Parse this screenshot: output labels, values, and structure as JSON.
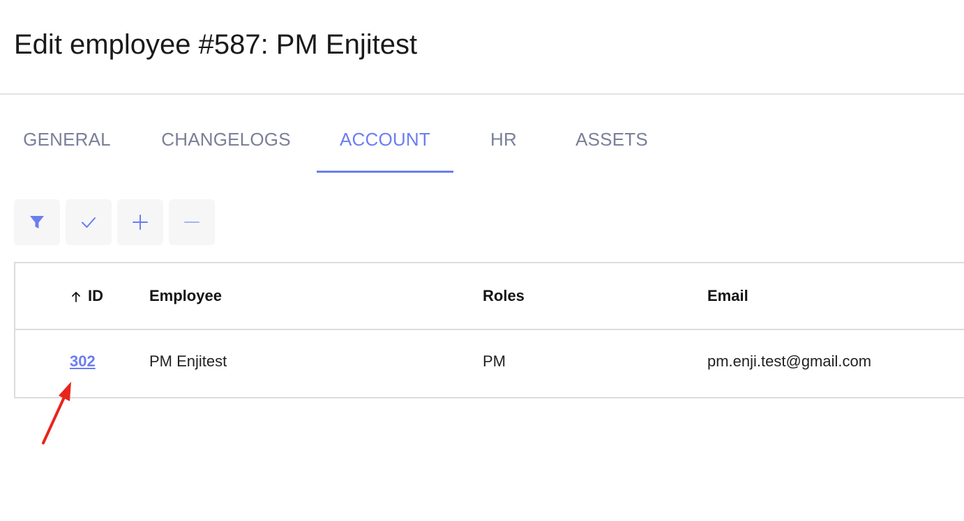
{
  "page": {
    "title": "Edit employee #587: PM Enjitest"
  },
  "tabs": [
    {
      "label": "GENERAL",
      "active": false
    },
    {
      "label": "CHANGELOGS",
      "active": false
    },
    {
      "label": "ACCOUNT",
      "active": true
    },
    {
      "label": "HR",
      "active": false
    },
    {
      "label": "ASSETS",
      "active": false
    }
  ],
  "toolbar": {
    "buttons": [
      {
        "icon": "filter-icon"
      },
      {
        "icon": "check-icon"
      },
      {
        "icon": "plus-icon"
      },
      {
        "icon": "minus-icon"
      }
    ]
  },
  "table": {
    "columns": [
      "ID",
      "Employee",
      "Roles",
      "Email"
    ],
    "sort": {
      "column": "ID",
      "direction": "ascending",
      "icon": "arrow-up-icon"
    },
    "rows": [
      {
        "id": "302",
        "employee": "PM Enjitest",
        "roles": "PM",
        "email": "pm.enji.test@gmail.com"
      }
    ]
  },
  "colors": {
    "accent": "#6b7ef0",
    "tab_inactive": "#7a7f98",
    "annotation": "#e8251c"
  }
}
